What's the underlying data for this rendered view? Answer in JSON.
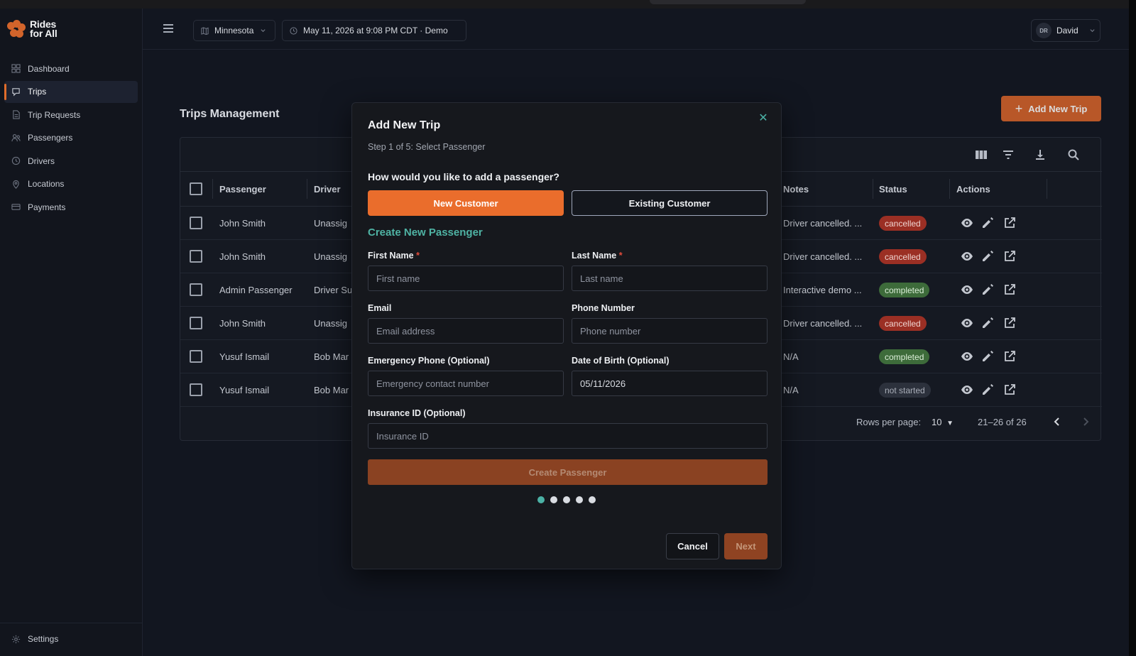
{
  "brand": {
    "line1": "Rides",
    "line2": "for All"
  },
  "sidebar": {
    "items": [
      {
        "label": "Dashboard",
        "icon": "grid-icon"
      },
      {
        "label": "Trips",
        "icon": "chat-route-icon",
        "active": true
      },
      {
        "label": "Trip Requests",
        "icon": "document-icon"
      },
      {
        "label": "Passengers",
        "icon": "people-icon"
      },
      {
        "label": "Drivers",
        "icon": "clock-icon"
      },
      {
        "label": "Locations",
        "icon": "pin-icon"
      },
      {
        "label": "Payments",
        "icon": "card-icon"
      }
    ],
    "settings_label": "Settings"
  },
  "topbar": {
    "region": "Minnesota",
    "datetime": "May 11, 2026 at 9:08 PM CDT · Demo",
    "user_initials": "DR",
    "user_name": "David"
  },
  "main": {
    "title": "Trips Management",
    "add_button": "Add New Trip",
    "columns": {
      "passenger": "Passenger",
      "driver": "Driver",
      "notes": "Notes",
      "status": "Status",
      "actions": "Actions"
    },
    "rows": [
      {
        "passenger": "John Smith",
        "driver": "Unassig",
        "notes": "Driver cancelled. ...",
        "status": "cancelled"
      },
      {
        "passenger": "John Smith",
        "driver": "Unassig",
        "notes": "Driver cancelled. ...",
        "status": "cancelled"
      },
      {
        "passenger": "Admin Passenger",
        "driver": "Driver Su",
        "notes": "Interactive demo ...",
        "status": "completed"
      },
      {
        "passenger": "John Smith",
        "driver": "Unassig",
        "notes": "Driver cancelled. ...",
        "status": "cancelled"
      },
      {
        "passenger": "Yusuf Ismail",
        "driver": "Bob Mar",
        "notes": "N/A",
        "status": "completed"
      },
      {
        "passenger": "Yusuf Ismail",
        "driver": "Bob Mar",
        "notes": "N/A",
        "status": "not started"
      }
    ],
    "pager": {
      "rows_label": "Rows per page:",
      "rows_value": "10",
      "range": "21–26 of 26"
    }
  },
  "modal": {
    "title": "Add New Trip",
    "subtitle": "Step 1 of 5: Select Passenger",
    "question": "How would you like to add a passenger?",
    "new_customer": "New Customer",
    "existing_customer": "Existing Customer",
    "section_title": "Create New Passenger",
    "fields": {
      "first_name": {
        "label": "First Name",
        "placeholder": "First name",
        "required": "*"
      },
      "last_name": {
        "label": "Last Name",
        "placeholder": "Last name",
        "required": "*"
      },
      "email": {
        "label": "Email",
        "placeholder": "Email address"
      },
      "phone": {
        "label": "Phone Number",
        "placeholder": "Phone number"
      },
      "emergency": {
        "label": "Emergency Phone (Optional)",
        "placeholder": "Emergency contact number"
      },
      "dob": {
        "label": "Date of Birth (Optional)",
        "value": "05/11/2026"
      },
      "insurance": {
        "label": "Insurance ID (Optional)",
        "placeholder": "Insurance ID"
      }
    },
    "create_button": "Create Passenger",
    "steps": {
      "current": 1,
      "total": 5
    },
    "cancel_button": "Cancel",
    "next_button": "Next"
  },
  "colors": {
    "accent": "#ea6d2c",
    "teal": "#4fb3a4",
    "cancelled": "#9b2f24",
    "completed": "#3d6b3a"
  }
}
